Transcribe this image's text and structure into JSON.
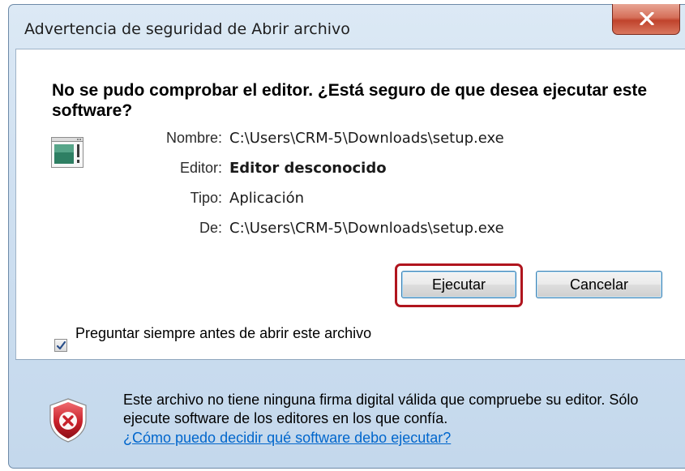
{
  "window": {
    "title": "Advertencia de seguridad de Abrir archivo"
  },
  "dialog": {
    "heading": "No se pudo comprobar el editor. ¿Está seguro de que desea ejecutar este software?",
    "fields": {
      "name_label": "Nombre:",
      "name_value": "C:\\Users\\CRM-5\\Downloads\\setup.exe",
      "publisher_label": "Editor:",
      "publisher_value": "Editor desconocido",
      "type_label": "Tipo:",
      "type_value": "Aplicación",
      "from_label": "De:",
      "from_value": "C:\\Users\\CRM-5\\Downloads\\setup.exe"
    },
    "buttons": {
      "run_label": "Ejecutar",
      "cancel_label": "Cancelar"
    },
    "checkbox": {
      "label": "Preguntar siempre antes de abrir este archivo",
      "checked": true
    }
  },
  "footer": {
    "warning_text": "Este archivo no tiene ninguna firma digital válida que compruebe su editor. Sólo ejecute software de los editores en los que confía.",
    "help_link": "¿Cómo puedo decidir qué software debo ejecutar?"
  },
  "colors": {
    "highlight": "#b0151e",
    "link": "#0066cc",
    "close_button": "#c0432c",
    "shield": "#c8202a"
  },
  "icons": {
    "close": "close-icon",
    "app": "application-icon",
    "checkbox": "checkmark-icon",
    "shield": "security-shield-icon"
  }
}
